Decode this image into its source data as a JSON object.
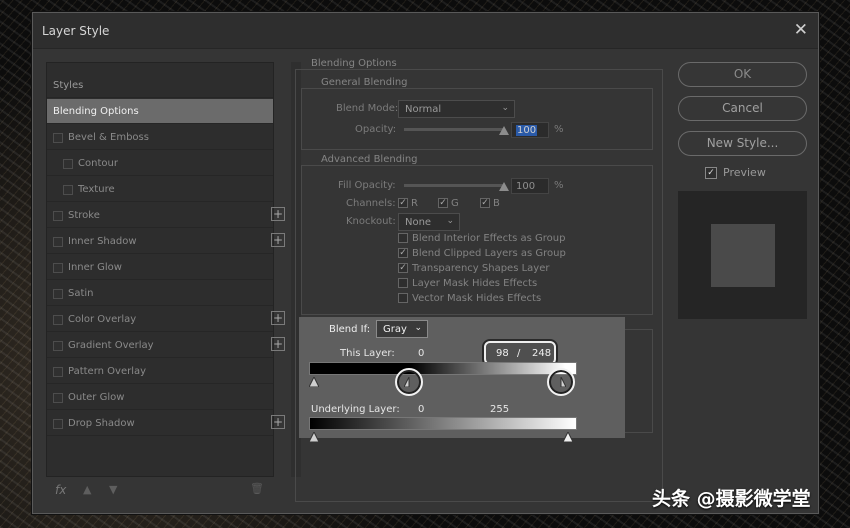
{
  "dialog": {
    "title": "Layer Style",
    "close": "✕"
  },
  "left_panel": {
    "items": [
      {
        "label": "Styles",
        "type": "header",
        "checkbox": false,
        "plus": false
      },
      {
        "label": "Blending Options",
        "type": "active",
        "checkbox": false,
        "plus": false
      },
      {
        "label": "Bevel & Emboss",
        "type": "item",
        "checkbox": true,
        "plus": false
      },
      {
        "label": "Contour",
        "type": "sub",
        "checkbox": true,
        "plus": false
      },
      {
        "label": "Texture",
        "type": "sub",
        "checkbox": true,
        "plus": false
      },
      {
        "label": "Stroke",
        "type": "item",
        "checkbox": true,
        "plus": true
      },
      {
        "label": "Inner Shadow",
        "type": "item",
        "checkbox": true,
        "plus": true
      },
      {
        "label": "Inner Glow",
        "type": "item",
        "checkbox": true,
        "plus": false
      },
      {
        "label": "Satin",
        "type": "item",
        "checkbox": true,
        "plus": false
      },
      {
        "label": "Color Overlay",
        "type": "item",
        "checkbox": true,
        "plus": true
      },
      {
        "label": "Gradient Overlay",
        "type": "item",
        "checkbox": true,
        "plus": true
      },
      {
        "label": "Pattern Overlay",
        "type": "item",
        "checkbox": true,
        "plus": false
      },
      {
        "label": "Outer Glow",
        "type": "item",
        "checkbox": true,
        "plus": false
      },
      {
        "label": "Drop Shadow",
        "type": "item",
        "checkbox": true,
        "plus": true
      }
    ],
    "fx_label": "fx",
    "up_icon": "▲",
    "down_icon": "▼",
    "trash_icon": "🗑"
  },
  "blending": {
    "section_title": "Blending Options",
    "general": {
      "title": "General Blending",
      "blend_mode_label": "Blend Mode:",
      "blend_mode_value": "Normal",
      "opacity_label": "Opacity:",
      "opacity_value": "100",
      "opacity_unit": "%",
      "opacity_level": 1.0
    },
    "advanced": {
      "title": "Advanced Blending",
      "fill_label": "Fill Opacity:",
      "fill_value": "100",
      "fill_unit": "%",
      "fill_level": 1.0,
      "channels_label": "Channels:",
      "channels": [
        "R",
        "G",
        "B"
      ],
      "knockout_label": "Knockout:",
      "knockout_value": "None",
      "options": [
        {
          "label": "Blend Interior Effects as Group",
          "checked": false
        },
        {
          "label": "Blend Clipped Layers as Group",
          "checked": true
        },
        {
          "label": "Transparency Shapes Layer",
          "checked": true
        },
        {
          "label": "Layer Mask Hides Effects",
          "checked": false
        },
        {
          "label": "Vector Mask Hides Effects",
          "checked": false
        }
      ]
    },
    "blend_if": {
      "label": "Blend If:",
      "value": "Gray",
      "this_layer_label": "This Layer:",
      "this_layer_low": "0",
      "this_layer_mid": "98",
      "this_layer_sep": "/",
      "this_layer_high": "248",
      "underlying_label": "Underlying Layer:",
      "underlying_low": "0",
      "underlying_high": "255"
    }
  },
  "buttons": {
    "ok": "OK",
    "cancel": "Cancel",
    "new_style": "New Style...",
    "preview_label": "Preview",
    "preview_checked": true
  },
  "watermark": "头条 @摄影微学堂"
}
